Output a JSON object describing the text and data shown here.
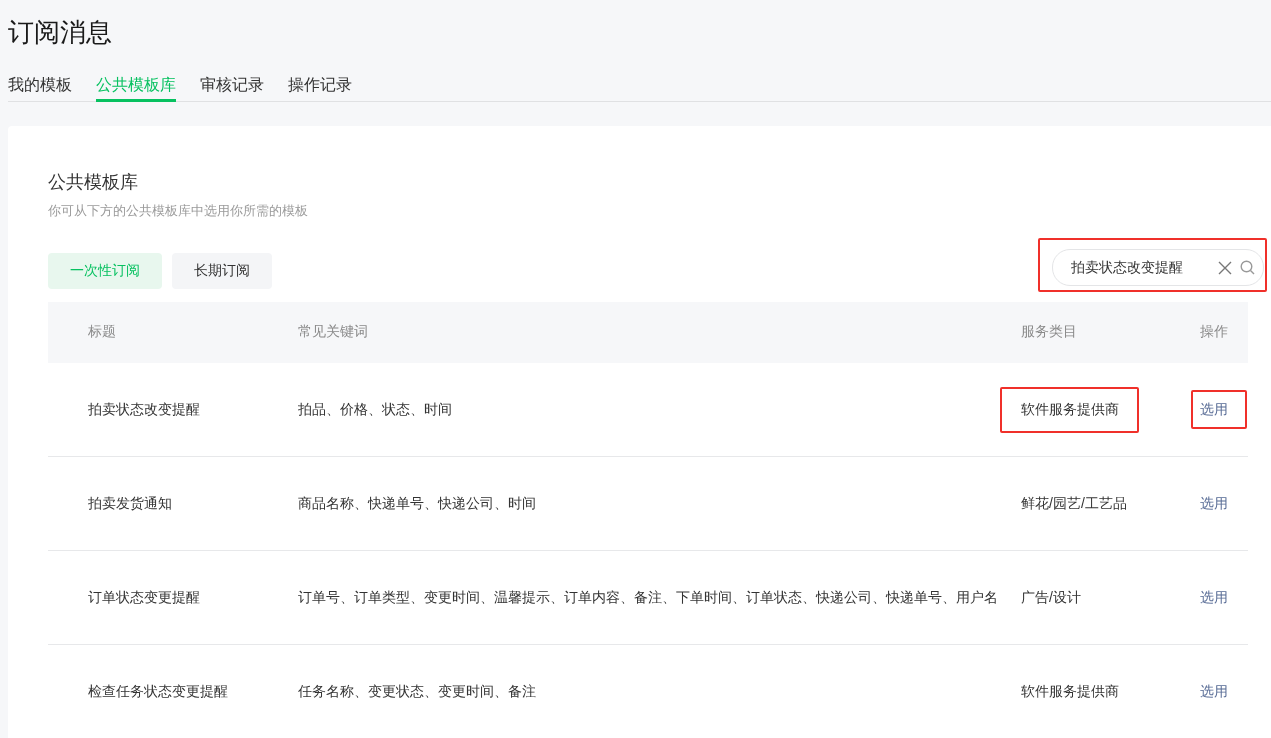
{
  "page": {
    "title": "订阅消息"
  },
  "tabs": [
    {
      "label": "我的模板",
      "selected": false
    },
    {
      "label": "公共模板库",
      "selected": true
    },
    {
      "label": "审核记录",
      "selected": false
    },
    {
      "label": "操作记录",
      "selected": false
    }
  ],
  "section": {
    "title": "公共模板库",
    "description": "你可从下方的公共模板库中选用你所需的模板"
  },
  "filters": [
    {
      "label": "一次性订阅",
      "selected": true
    },
    {
      "label": "长期订阅",
      "selected": false
    }
  ],
  "search": {
    "value": "拍卖状态改变提醒",
    "highlighted": true
  },
  "table": {
    "columns": [
      "标题",
      "常见关键词",
      "服务类目",
      "操作"
    ],
    "rows": [
      {
        "title": "拍卖状态改变提醒",
        "keywords": "拍品、价格、状态、时间",
        "category": "软件服务提供商",
        "category_highlighted": true,
        "action": "选用",
        "action_highlighted": true
      },
      {
        "title": "拍卖发货通知",
        "keywords": "商品名称、快递单号、快递公司、时间",
        "category": "鲜花/园艺/工艺品",
        "category_highlighted": false,
        "action": "选用",
        "action_highlighted": false
      },
      {
        "title": "订单状态变更提醒",
        "keywords": "订单号、订单类型、变更时间、温馨提示、订单内容、备注、下单时间、订单状态、快递公司、快递单号、用户名",
        "category": "广告/设计",
        "category_highlighted": false,
        "action": "选用",
        "action_highlighted": false
      },
      {
        "title": "检查任务状态变更提醒",
        "keywords": "任务名称、变更状态、变更时间、备注",
        "category": "软件服务提供商",
        "category_highlighted": false,
        "action": "选用",
        "action_highlighted": false
      }
    ]
  }
}
